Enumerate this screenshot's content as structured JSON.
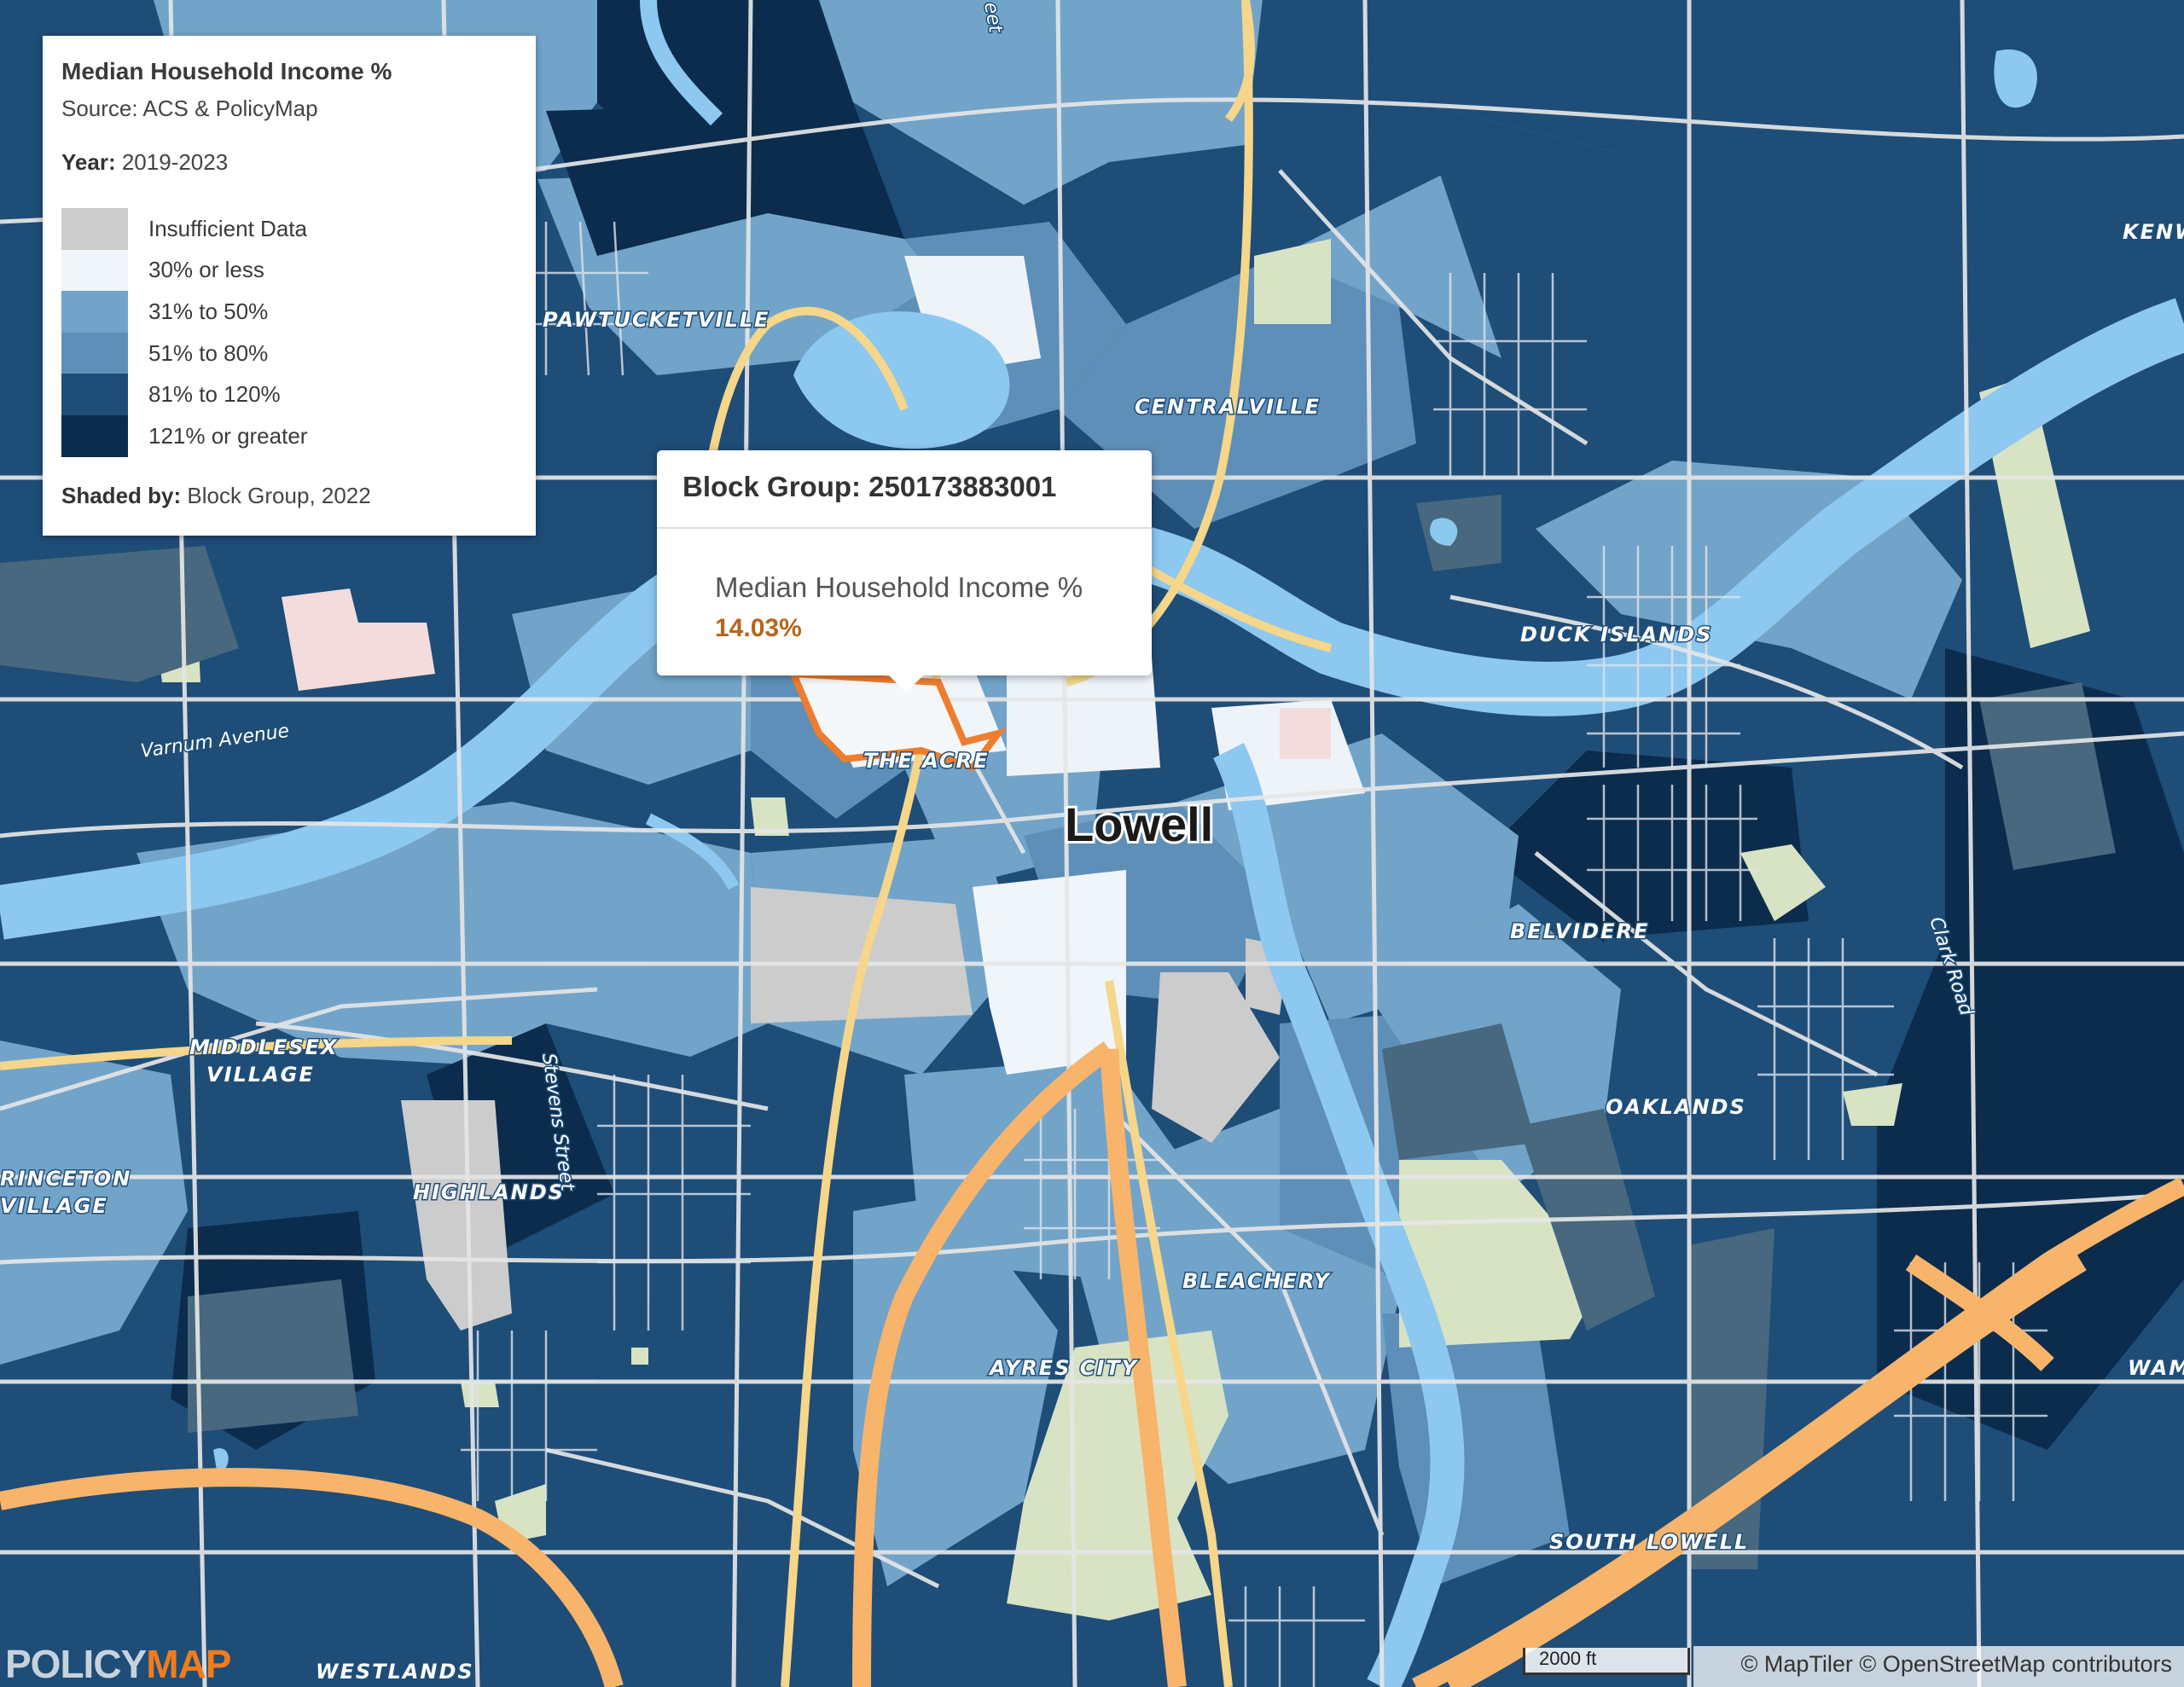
{
  "legend": {
    "title": "Median Household Income %",
    "source": "Source: ACS & PolicyMap",
    "year_label": "Year:",
    "year_value": "2019-2023",
    "items": [
      {
        "label": "Insufficient Data",
        "color": "#cccccc"
      },
      {
        "label": "30% or less",
        "color": "#f0f5fa"
      },
      {
        "label": "31% to 50%",
        "color": "#72a4c9"
      },
      {
        "label": "51% to 80%",
        "color": "#5e8fb8"
      },
      {
        "label": "81% to 120%",
        "color": "#1e4d78"
      },
      {
        "label": "121% or greater",
        "color": "#0b2c4d"
      }
    ],
    "shaded_label": "Shaded by:",
    "shaded_value": "Block Group, 2022"
  },
  "popup": {
    "header": "Block Group: 250173883001",
    "metric": "Median Household Income %",
    "value": "14.03%"
  },
  "map": {
    "city_label": "Lowell",
    "place_labels": [
      "PAWTUCKETVILLE",
      "CENTRALVILLE",
      "DUCK ISLANDS",
      "THE ACRE",
      "BELVIDERE",
      "MIDDLESEX",
      "VILLAGE",
      "HIGHLANDS",
      "OAKLANDS",
      "BLEACHERY",
      "AYRES CITY",
      "SOUTH LOWELL",
      "WESTLANDS",
      "RINCETON",
      "VILLAGE",
      "KENW",
      "WAMI"
    ],
    "road_labels": [
      "Varnum Avenue",
      "Stevens Street",
      "Clark Road",
      "eet"
    ],
    "colors": {
      "water": "#8cc8f0",
      "road": "#e6e6e6",
      "highway": "#f7b46a",
      "arterial": "#f5d68a",
      "park": "#d8e3c4",
      "pink": "#f3dcdc",
      "highlight": "#ef7d2e"
    }
  },
  "bottom": {
    "logo_a": "POLICY",
    "logo_b": "MAP",
    "scale_label": "2000 ft",
    "attribution": "© MapTiler © OpenStreetMap contributors"
  }
}
